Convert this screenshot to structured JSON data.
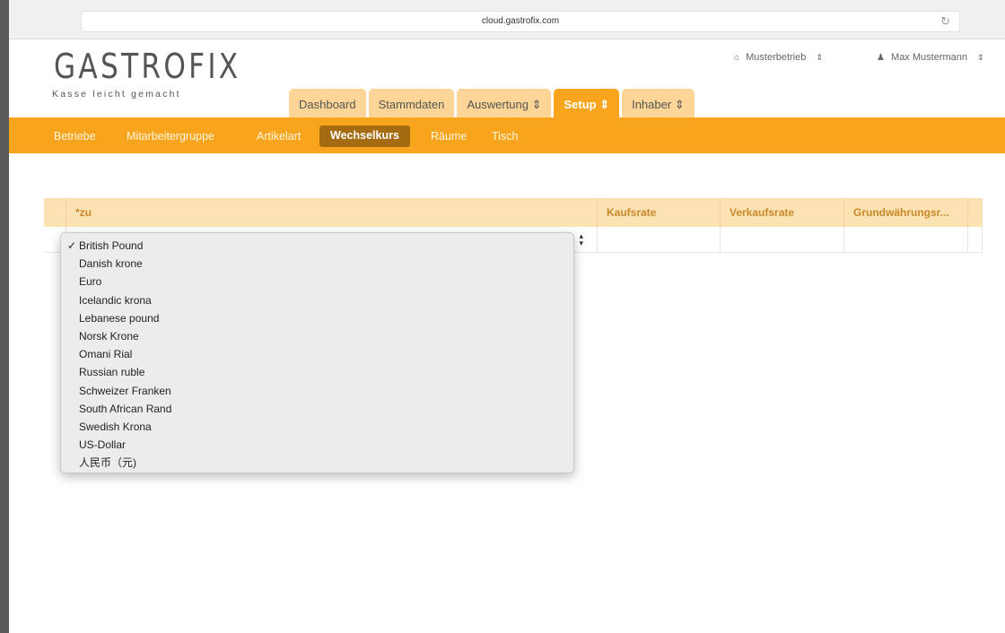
{
  "browser": {
    "url": "cloud.gastrofix.com",
    "reload_icon": "↻"
  },
  "logo": {
    "title": "GASTROFIX",
    "subtitle": "Kasse leicht gemacht"
  },
  "topbar": {
    "business": {
      "icon": "home-icon",
      "label": "Musterbetrieb"
    },
    "user": {
      "icon": "user-icon",
      "label": "Max Mustermann"
    },
    "sort_glyph": "⇕"
  },
  "main_tabs": [
    {
      "label": "Dashboard"
    },
    {
      "label": "Stammdaten"
    },
    {
      "label": "Auswertung ⇕"
    },
    {
      "label": "Setup ⇕",
      "active": true
    },
    {
      "label": "Inhaber ⇕"
    }
  ],
  "sub_nav": [
    {
      "label": "Betriebe"
    },
    {
      "label": "Mitarbeitergruppe"
    },
    {
      "label": "Artikelart"
    },
    {
      "label": "Wechselkurs",
      "active": true
    },
    {
      "label": "Räume"
    },
    {
      "label": "Tisch"
    }
  ],
  "table": {
    "columns": [
      "*zu",
      "Kaufsrate",
      "Verkaufsrate",
      "Grundwährungsr..."
    ]
  },
  "dropdown": {
    "selected": "British Pound",
    "check_glyph": "✓",
    "options": [
      "British Pound",
      "Danish krone",
      "Euro",
      "Icelandic krona",
      "Lebanese pound",
      "Norsk Krone",
      "Omani Rial",
      "Russian ruble",
      "Schweizer Franken",
      "South African Rand",
      "Swedish Krona",
      "US-Dollar",
      "人民币（元)"
    ]
  },
  "colors": {
    "accent": "#f8a51d",
    "tab_inactive": "#fcd597",
    "sub_active": "#a56b10",
    "table_header": "#fde2b4"
  }
}
